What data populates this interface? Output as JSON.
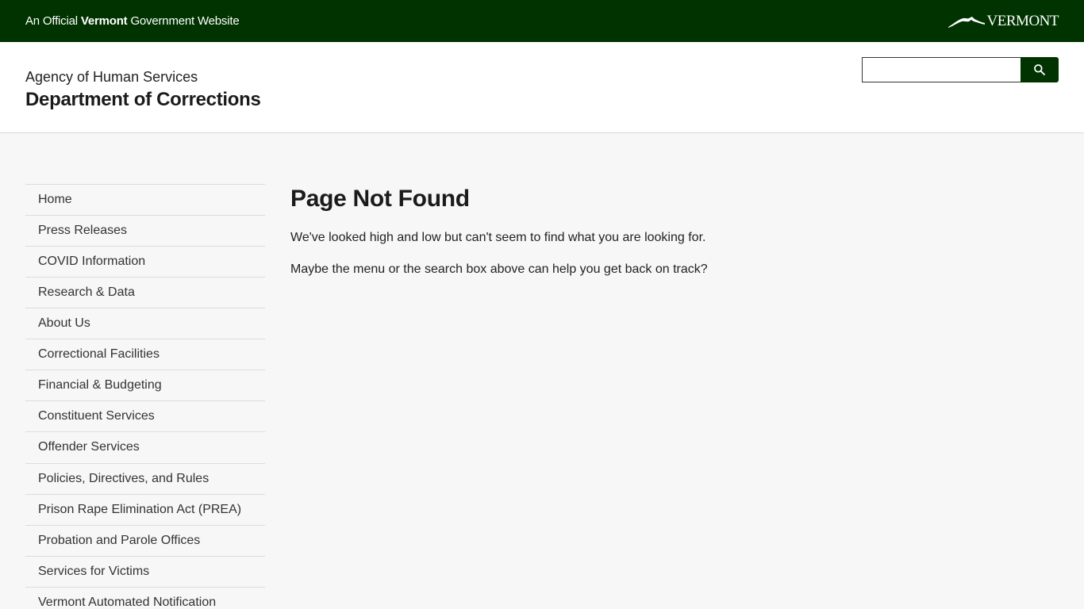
{
  "topbar": {
    "official_prefix": "An Official ",
    "official_bold": "Vermont",
    "official_suffix": " Government Website",
    "logo_text": "VERMONT",
    "bg_color": "#003300"
  },
  "header": {
    "agency": "Agency of Human Services",
    "department": "Department of Corrections"
  },
  "search": {
    "placeholder": "",
    "button_icon": "search-icon"
  },
  "sidebar": {
    "items": [
      {
        "label": "Home"
      },
      {
        "label": "Press Releases"
      },
      {
        "label": "COVID Information"
      },
      {
        "label": "Research & Data"
      },
      {
        "label": "About Us"
      },
      {
        "label": "Correctional Facilities"
      },
      {
        "label": "Financial & Budgeting"
      },
      {
        "label": "Constituent Services"
      },
      {
        "label": "Offender Services"
      },
      {
        "label": "Policies, Directives, and Rules"
      },
      {
        "label": "Prison Rape Elimination Act (PREA)"
      },
      {
        "label": "Probation and Parole Offices"
      },
      {
        "label": "Services for Victims"
      },
      {
        "label": "Vermont Automated Notification"
      }
    ]
  },
  "content": {
    "title": "Page Not Found",
    "paragraph1": "We've looked high and low but can't seem to find what you are looking for.",
    "paragraph2": "Maybe the menu or the search box above can help you get back on track?"
  }
}
